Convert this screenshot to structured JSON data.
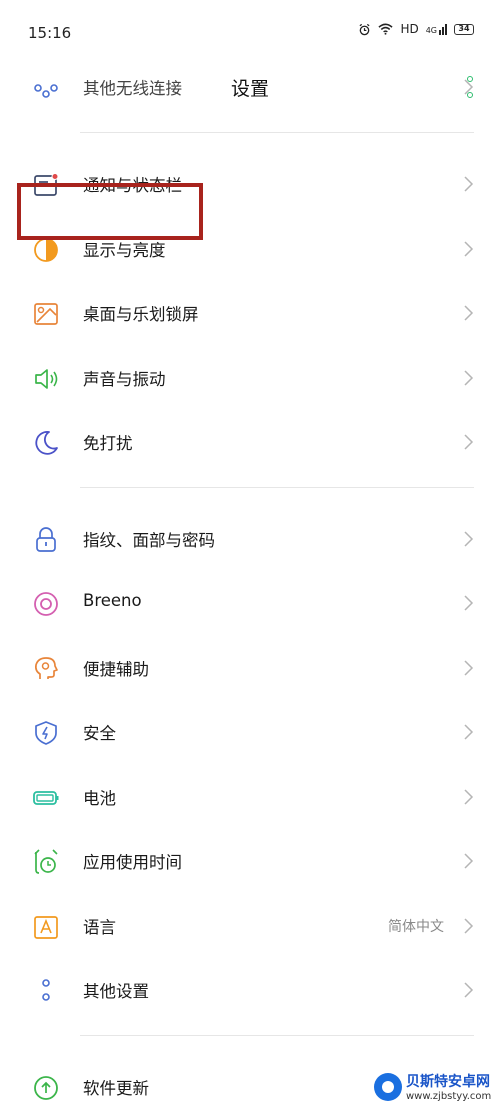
{
  "status_bar": {
    "time": "15:16",
    "network": "HD",
    "signal": "4G",
    "battery": "34"
  },
  "header": {
    "title": "设置"
  },
  "colors": {
    "accent_green": "#2dbd6e",
    "highlight_red": "#a8231d"
  },
  "groups": [
    {
      "items": [
        {
          "label": "其他无线连接",
          "icon": "share-nodes-icon",
          "partial": true
        }
      ]
    },
    {
      "items": [
        {
          "label": "通知与状态栏",
          "icon": "notification-icon",
          "highlighted": true
        },
        {
          "label": "显示与亮度",
          "icon": "brightness-icon"
        },
        {
          "label": "桌面与乐划锁屏",
          "icon": "wallpaper-icon"
        },
        {
          "label": "声音与振动",
          "icon": "speaker-icon"
        },
        {
          "label": "免打扰",
          "icon": "moon-icon"
        }
      ]
    },
    {
      "items": [
        {
          "label": "指纹、面部与密码",
          "icon": "lock-icon"
        },
        {
          "label": "Breeno",
          "icon": "breeno-icon"
        },
        {
          "label": "便捷辅助",
          "icon": "assist-icon"
        },
        {
          "label": "安全",
          "icon": "shield-icon"
        },
        {
          "label": "电池",
          "icon": "battery-icon"
        },
        {
          "label": "应用使用时间",
          "icon": "clock-icon"
        },
        {
          "label": "语言",
          "icon": "language-icon",
          "value": "简体中文"
        },
        {
          "label": "其他设置",
          "icon": "more-settings-icon"
        }
      ]
    },
    {
      "items": [
        {
          "label": "软件更新",
          "icon": "update-icon",
          "partial": true
        }
      ]
    }
  ],
  "watermark": {
    "name": "贝斯特安卓网",
    "url": "www.zjbstyy.com"
  }
}
